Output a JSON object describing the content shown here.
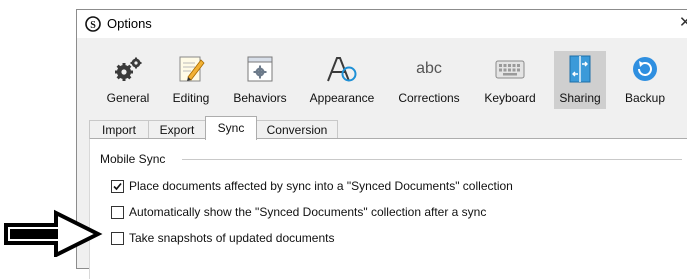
{
  "window": {
    "title": "Options",
    "close_glyph": "✕"
  },
  "toolbar": {
    "items": [
      {
        "label": "General",
        "icon": "gears-icon"
      },
      {
        "label": "Editing",
        "icon": "pencil-note-icon"
      },
      {
        "label": "Behaviors",
        "icon": "window-gear-icon"
      },
      {
        "label": "Appearance",
        "icon": "font-a-icon"
      },
      {
        "label": "Corrections",
        "icon": "abc-icon",
        "icon_text": "abc"
      },
      {
        "label": "Keyboard",
        "icon": "keyboard-icon"
      },
      {
        "label": "Sharing",
        "icon": "sharing-arrows-icon",
        "active": true
      },
      {
        "label": "Backup",
        "icon": "backup-circle-icon"
      }
    ]
  },
  "tabs": [
    {
      "label": "Import"
    },
    {
      "label": "Export"
    },
    {
      "label": "Sync",
      "active": true
    },
    {
      "label": "Conversion"
    }
  ],
  "panel": {
    "group_label": "Mobile Sync",
    "options": [
      {
        "label": "Place documents affected by sync into a \"Synced Documents\" collection",
        "checked": true
      },
      {
        "label": "Automatically show the \"Synced Documents\" collection after a sync",
        "checked": false
      },
      {
        "label": "Take snapshots of updated documents",
        "checked": false
      }
    ]
  },
  "colors": {
    "accent": "#1e90d6",
    "active_tool_bg": "#cfcfcf",
    "panel_bg": "#ffffff",
    "chrome_bg": "#f0f0f0"
  }
}
